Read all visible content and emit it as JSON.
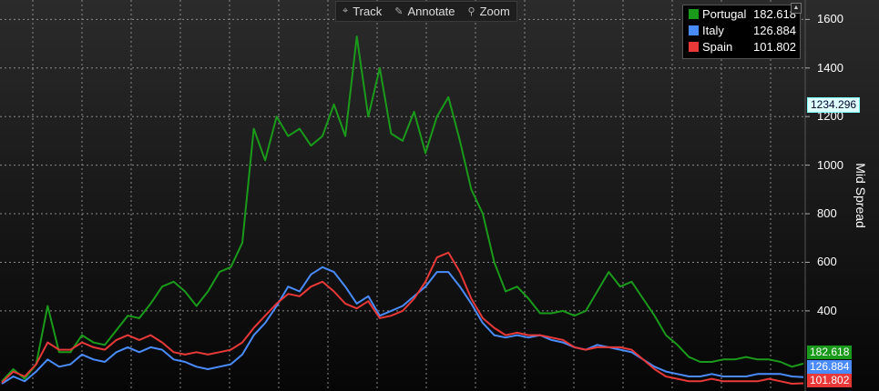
{
  "toolbar": {
    "track_label": "Track",
    "annotate_label": "Annotate",
    "zoom_label": "Zoom",
    "icons": [
      "crosshair-icon",
      "pencil-icon",
      "magnifier-icon"
    ]
  },
  "chart_data": {
    "type": "line",
    "ylabel": "Mid Spread",
    "ylim": [
      70,
      1680
    ],
    "yticks": [
      400,
      600,
      800,
      1000,
      1200,
      1400,
      1600
    ],
    "ytick_labels": [
      "400",
      "600",
      "800",
      "1000",
      "1200",
      "1400",
      "1600"
    ],
    "grid": true,
    "legend_position": "top-right",
    "crosshair_value": "1234.296",
    "x": [
      0,
      1,
      2,
      3,
      4,
      5,
      6,
      7,
      8,
      9,
      10,
      11,
      12,
      13,
      14,
      15,
      16,
      17,
      18,
      19,
      20,
      21,
      22,
      23,
      24,
      25,
      26,
      27,
      28,
      29,
      30,
      31,
      32,
      33,
      34,
      35,
      36,
      37,
      38,
      39,
      40,
      41,
      42,
      43,
      44,
      45,
      46,
      47,
      48,
      49,
      50,
      51,
      52,
      53,
      54,
      55,
      56,
      57,
      58,
      59,
      60,
      61,
      62,
      63,
      64,
      65,
      66,
      67,
      68,
      69,
      70
    ],
    "series": [
      {
        "name": "Portugal",
        "last_value": "182.618",
        "color": "#1a9a1a",
        "values": [
          110,
          160,
          120,
          180,
          420,
          230,
          230,
          300,
          270,
          260,
          320,
          380,
          370,
          430,
          500,
          520,
          480,
          420,
          480,
          560,
          580,
          680,
          1150,
          1020,
          1200,
          1120,
          1150,
          1080,
          1120,
          1250,
          1120,
          1530,
          1200,
          1400,
          1130,
          1100,
          1220,
          1050,
          1200,
          1280,
          1100,
          900,
          800,
          600,
          480,
          500,
          450,
          390,
          390,
          400,
          380,
          400,
          480,
          560,
          500,
          520,
          450,
          380,
          300,
          260,
          210,
          190,
          190,
          200,
          200,
          210,
          200,
          200,
          190,
          170,
          182.6
        ]
      },
      {
        "name": "Italy",
        "last_value": "126.884",
        "color": "#4a8cff",
        "values": [
          100,
          130,
          110,
          150,
          200,
          170,
          180,
          220,
          200,
          190,
          230,
          250,
          230,
          250,
          240,
          200,
          190,
          170,
          160,
          170,
          180,
          220,
          300,
          350,
          420,
          500,
          480,
          550,
          580,
          560,
          500,
          430,
          460,
          380,
          400,
          420,
          460,
          500,
          560,
          560,
          500,
          430,
          350,
          300,
          290,
          300,
          290,
          300,
          280,
          270,
          250,
          240,
          260,
          250,
          240,
          230,
          200,
          170,
          150,
          140,
          130,
          130,
          140,
          130,
          130,
          130,
          140,
          140,
          140,
          130,
          126.9
        ]
      },
      {
        "name": "Spain",
        "last_value": "101.802",
        "color": "#e83838",
        "values": [
          105,
          150,
          130,
          180,
          270,
          240,
          240,
          270,
          250,
          240,
          280,
          300,
          280,
          300,
          270,
          230,
          220,
          230,
          220,
          230,
          240,
          270,
          330,
          380,
          430,
          470,
          460,
          500,
          520,
          480,
          430,
          410,
          440,
          370,
          380,
          400,
          450,
          520,
          620,
          640,
          560,
          450,
          370,
          330,
          300,
          310,
          300,
          300,
          290,
          280,
          250,
          240,
          250,
          250,
          250,
          240,
          200,
          160,
          130,
          120,
          110,
          110,
          120,
          110,
          110,
          110,
          110,
          120,
          110,
          100,
          101.8
        ]
      }
    ]
  }
}
